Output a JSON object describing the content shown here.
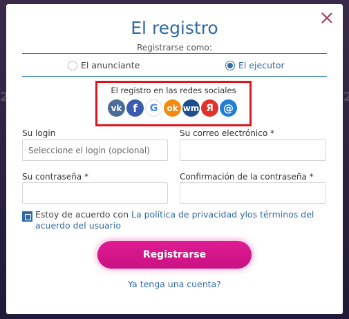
{
  "modal": {
    "title": "El registro",
    "subtitle": "Registrarse como:"
  },
  "role": {
    "option1": "El anunciante",
    "option2": "El ejecutor",
    "selected": "El ejecutor"
  },
  "social": {
    "title": "El registro en las redes sociales",
    "icons": [
      {
        "name": "vk-icon",
        "glyph": "vk",
        "color": "#4b6d96"
      },
      {
        "name": "facebook-icon",
        "glyph": "f",
        "color": "#3b5bb0"
      },
      {
        "name": "google-icon",
        "glyph": "G",
        "color": "#ffffff"
      },
      {
        "name": "odnoklassniki-icon",
        "glyph": "ok",
        "color": "#f28a0f"
      },
      {
        "name": "webmoney-icon",
        "glyph": "wm",
        "color": "#1c4f8f"
      },
      {
        "name": "yandex-icon",
        "glyph": "Я",
        "color": "#e0322b"
      },
      {
        "name": "mailru-icon",
        "glyph": "@",
        "color": "#1f7ed6"
      }
    ]
  },
  "form": {
    "login_label": "Su login",
    "login_placeholder": "Seleccione el login (opcional)",
    "email_label": "Su correo electrónico *",
    "password_label": "Su contraseña *",
    "confirm_label": "Confirmación de la contraseña *"
  },
  "agreement": {
    "text": "Estoy de acuerdo con",
    "privacy_link": "La política de privacidad",
    "terms_link": "ylos términos del acuerdo del usuario"
  },
  "actions": {
    "register": "Registrarse",
    "login_link": "Ya tenga una cuenta?"
  },
  "colors": {
    "accent": "#2f6aa3",
    "brand": "#d1158a",
    "highlight_border": "#e0141c"
  }
}
